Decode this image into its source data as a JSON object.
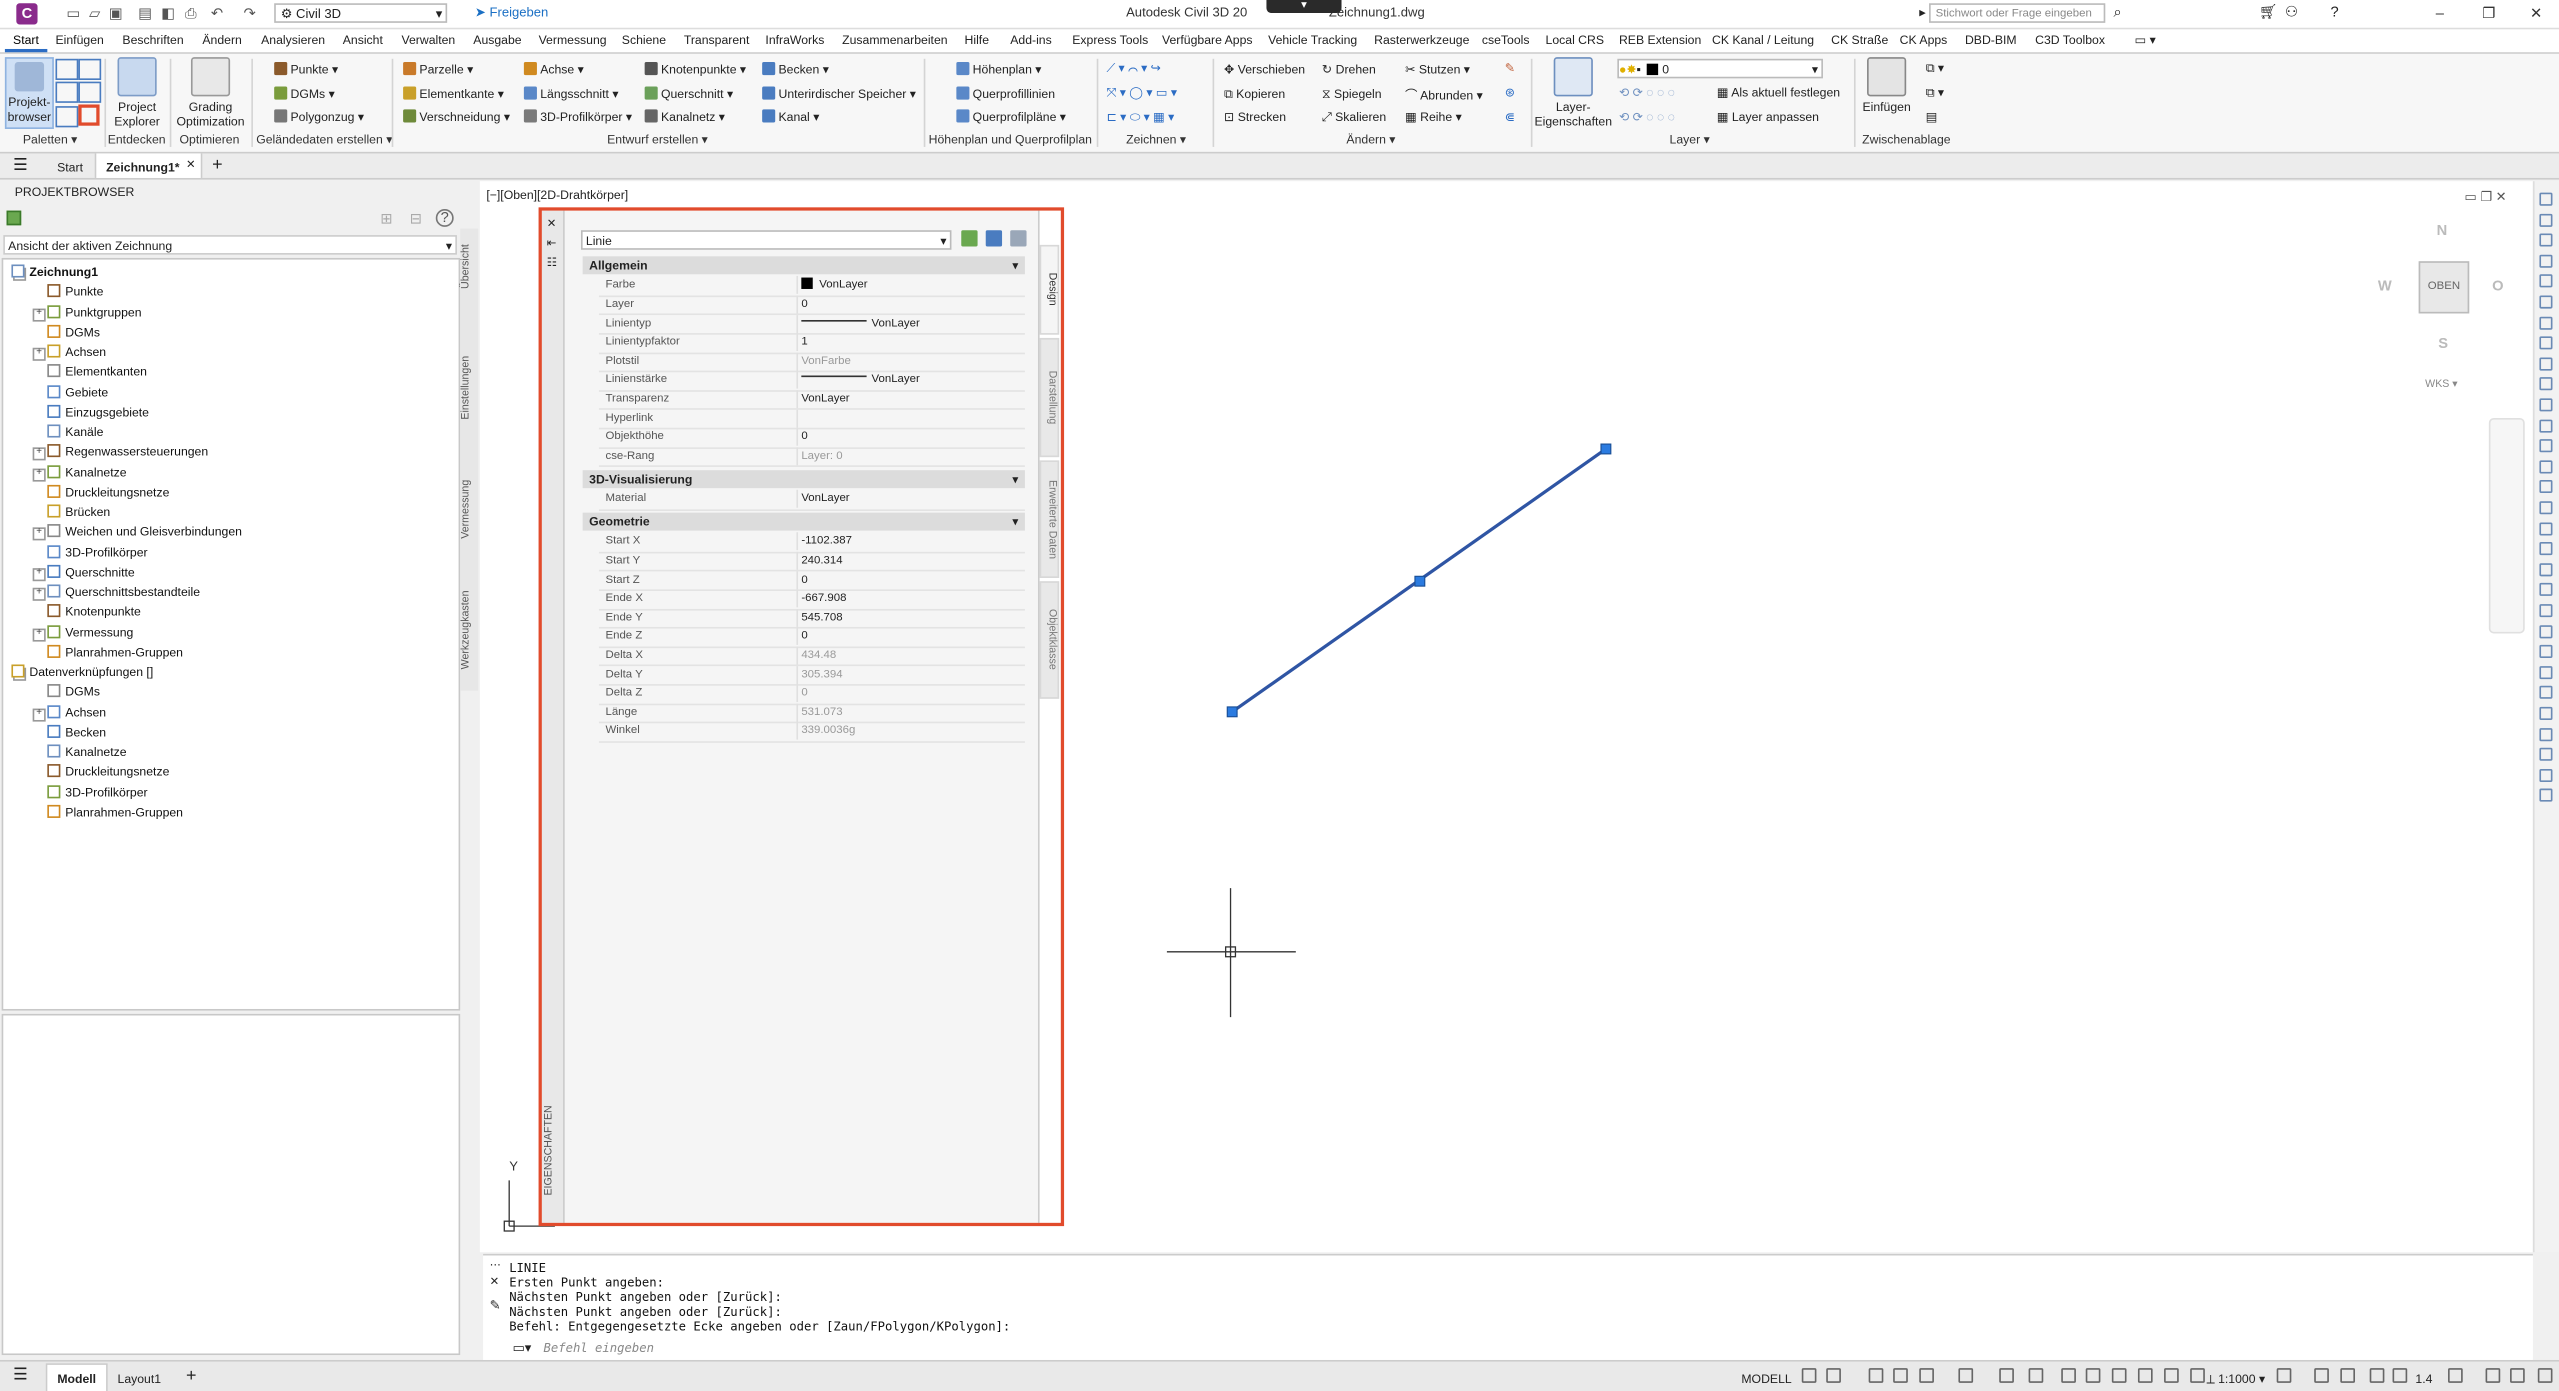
{
  "titlebar": {
    "workspace": "Civil 3D",
    "share": "Freigeben",
    "app_title": "Autodesk Civil 3D 20",
    "app_title_suffix": "Zeichnung1.dwg",
    "search_placeholder": "Stichwort oder Frage eingeben",
    "app_letter": "C"
  },
  "menu_tabs": [
    "Start",
    "Einfügen",
    "Beschriften",
    "Ändern",
    "Analysieren",
    "Ansicht",
    "Verwalten",
    "Ausgabe",
    "Vermessung",
    "Schiene",
    "Transparent",
    "InfraWorks",
    "Zusammenarbeiten",
    "Hilfe",
    "Add-ins",
    "Express Tools",
    "Verfügbare Apps",
    "Vehicle Tracking",
    "Rasterwerkzeuge",
    "cseTools",
    "Local CRS",
    "REB Extension",
    "CK Kanal / Leitung",
    "CK Straße",
    "CK Apps",
    "DBD-BIM",
    "C3D Toolbox"
  ],
  "ribbon": {
    "paletten": {
      "title": "Paletten",
      "btn": "Projekt-\nbrowser"
    },
    "entdecken": {
      "title": "Entdecken",
      "btn": "Project\nExplorer"
    },
    "optimieren": {
      "title": "Optimieren",
      "btn": "Grading\nOptimization"
    },
    "gelaende": {
      "title": "Geländedaten erstellen",
      "items": [
        "Punkte",
        "DGMs",
        "Polygonzug"
      ]
    },
    "entwurf": {
      "title": "Entwurf erstellen",
      "col1": [
        "Parzelle",
        "Elementkante",
        "Verschneidung"
      ],
      "col2": [
        "Achse",
        "Längsschnitt",
        "3D-Profilkörper"
      ],
      "col3": [
        "Knotenpunkte",
        "Querschnitt",
        "Kanalnetz"
      ],
      "col4": [
        "Becken",
        "Unterirdischer Speicher",
        "Kanal"
      ]
    },
    "hoehenplan": {
      "title": "Höhenplan und Querprofilplan",
      "items": [
        "Höhenplan",
        "Querprofillinien",
        "Querprofilpläne"
      ]
    },
    "zeichnen": {
      "title": "Zeichnen"
    },
    "aendern": {
      "title": "Ändern",
      "col1": [
        "Verschieben",
        "Kopieren",
        "Strecken"
      ],
      "col2": [
        "Drehen",
        "Spiegeln",
        "Skalieren"
      ],
      "col3": [
        "Stutzen",
        "Abrunden",
        "Reihe"
      ]
    },
    "layer": {
      "title": "Layer",
      "btn": "Layer-\nEigenschaften",
      "current": "0",
      "items": [
        "Als aktuell festlegen",
        "Layer anpassen"
      ]
    },
    "zwischenablage": {
      "title": "Zwischenablage",
      "btn": "Einfügen"
    }
  },
  "doctabs": {
    "start": "Start",
    "active": "Zeichnung1*"
  },
  "projectbrowser": {
    "header": "PROJEKTBROWSER",
    "view": "Ansicht der aktiven Zeichnung",
    "tree": [
      {
        "label": "Zeichnung1",
        "level": 0,
        "bold": true
      },
      {
        "label": "Punkte",
        "level": 1
      },
      {
        "label": "Punktgruppen",
        "level": 1,
        "exp": true
      },
      {
        "label": "DGMs",
        "level": 1
      },
      {
        "label": "Achsen",
        "level": 1,
        "exp": true
      },
      {
        "label": "Elementkanten",
        "level": 1
      },
      {
        "label": "Gebiete",
        "level": 1
      },
      {
        "label": "Einzugsgebiete",
        "level": 1
      },
      {
        "label": "Kanäle",
        "level": 1
      },
      {
        "label": "Regenwassersteuerungen",
        "level": 1,
        "exp": true
      },
      {
        "label": "Kanalnetze",
        "level": 1,
        "exp": true
      },
      {
        "label": "Druckleitungsnetze",
        "level": 1
      },
      {
        "label": "Brücken",
        "level": 1
      },
      {
        "label": "Weichen und Gleisverbindungen",
        "level": 1,
        "exp": true
      },
      {
        "label": "3D-Profilkörper",
        "level": 1
      },
      {
        "label": "Querschnitte",
        "level": 1,
        "exp": true
      },
      {
        "label": "Querschnittsbestandteile",
        "level": 1,
        "exp": true
      },
      {
        "label": "Knotenpunkte",
        "level": 1
      },
      {
        "label": "Vermessung",
        "level": 1,
        "exp": true
      },
      {
        "label": "Planrahmen-Gruppen",
        "level": 1
      },
      {
        "label": "Datenverknüpfungen []",
        "level": 0
      },
      {
        "label": "DGMs",
        "level": 1
      },
      {
        "label": "Achsen",
        "level": 1,
        "exp": true
      },
      {
        "label": "Becken",
        "level": 1
      },
      {
        "label": "Kanalnetze",
        "level": 1
      },
      {
        "label": "Druckleitungsnetze",
        "level": 1
      },
      {
        "label": "3D-Profilkörper",
        "level": 1
      },
      {
        "label": "Planrahmen-Gruppen",
        "level": 1
      }
    ],
    "side_tabs": [
      "Übersicht",
      "Einstellungen",
      "Vermessung",
      "Werkzeugkasten"
    ]
  },
  "viewport": {
    "label": "[−][Oben][2D-Drahtkörper]"
  },
  "properties": {
    "type": "Linie",
    "side_title": "EIGENSCHAFTEN",
    "tabs": [
      "Design",
      "Darstellung",
      "Erweiterte Daten",
      "Objektklasse"
    ],
    "sections": [
      {
        "name": "Allgemein",
        "rows": [
          {
            "k": "Farbe",
            "v": "VonLayer",
            "swatch": "#000000"
          },
          {
            "k": "Layer",
            "v": "0"
          },
          {
            "k": "Linientyp",
            "v": "VonLayer",
            "line": true
          },
          {
            "k": "Linientypfaktor",
            "v": "1"
          },
          {
            "k": "Plotstil",
            "v": "VonFarbe",
            "grey": true
          },
          {
            "k": "Linienstärke",
            "v": "VonLayer",
            "line": true
          },
          {
            "k": "Transparenz",
            "v": "VonLayer"
          },
          {
            "k": "Hyperlink",
            "v": ""
          },
          {
            "k": "Objekthöhe",
            "v": "0"
          },
          {
            "k": "cse-Rang",
            "v": "Layer: 0",
            "grey": true
          }
        ]
      },
      {
        "name": "3D-Visualisierung",
        "rows": [
          {
            "k": "Material",
            "v": "VonLayer"
          }
        ]
      },
      {
        "name": "Geometrie",
        "rows": [
          {
            "k": "Start X",
            "v": "-1102.387"
          },
          {
            "k": "Start Y",
            "v": "240.314"
          },
          {
            "k": "Start Z",
            "v": "0"
          },
          {
            "k": "Ende X",
            "v": "-667.908"
          },
          {
            "k": "Ende Y",
            "v": "545.708"
          },
          {
            "k": "Ende Z",
            "v": "0"
          },
          {
            "k": "Delta X",
            "v": "434.48",
            "grey": true
          },
          {
            "k": "Delta Y",
            "v": "305.394",
            "grey": true
          },
          {
            "k": "Delta Z",
            "v": "0",
            "grey": true
          },
          {
            "k": "Länge",
            "v": "531.073",
            "grey": true
          },
          {
            "k": "Winkel",
            "v": "339.0036g",
            "grey": true
          }
        ]
      }
    ]
  },
  "viewcube": {
    "n": "N",
    "s": "S",
    "w": "W",
    "e": "O",
    "top": "OBEN",
    "wcs": "WKS"
  },
  "ucs": {
    "y": "Y"
  },
  "command": {
    "lines": [
      "LINIE",
      "Ersten Punkt angeben:",
      "Nächsten Punkt angeben oder [Zurück]:",
      "Nächsten Punkt angeben oder [Zurück]:",
      "Befehl: Entgegengesetzte Ecke angeben oder [Zaun/FPolygon/KPolygon]:"
    ],
    "placeholder": "Befehl eingeben"
  },
  "status": {
    "model_tab": "Modell",
    "layout_tab": "Layout1",
    "model": "MODELL",
    "scale": "1:1000",
    "factor": "1.4"
  },
  "colors": {
    "accent": "#2b6cc4",
    "highlight": "#e14b2c",
    "line": "#2f55a4",
    "grip": "#2b7be0"
  }
}
